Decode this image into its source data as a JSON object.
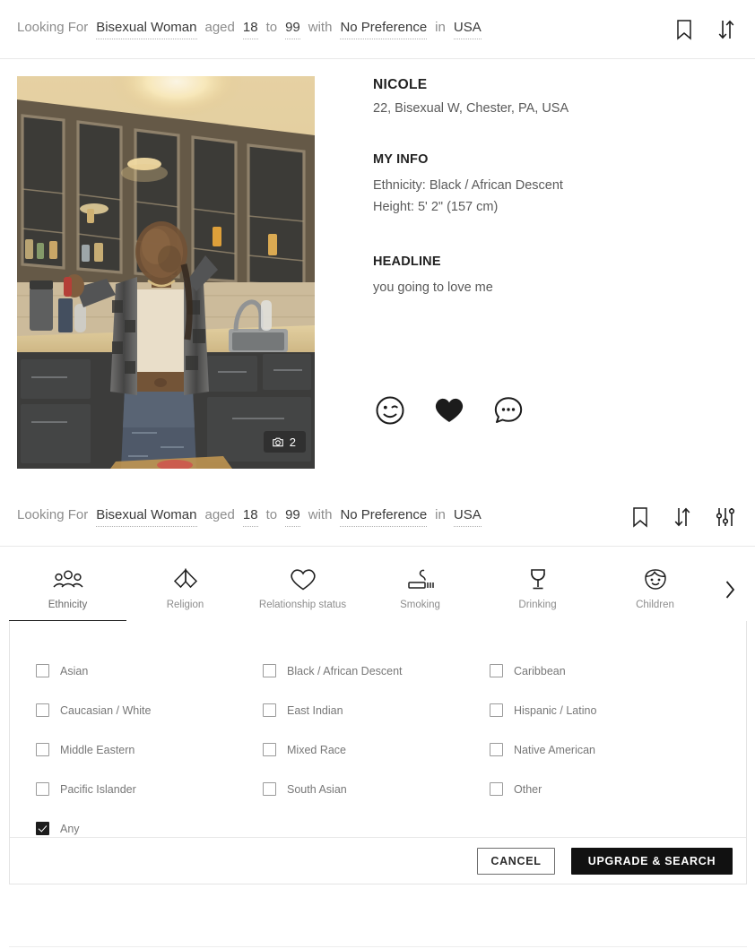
{
  "search_bar_top": {
    "segments": [
      {
        "text": "Looking For",
        "type": "word"
      },
      {
        "text": "Bisexual Woman",
        "type": "value"
      },
      {
        "text": "aged",
        "type": "word"
      },
      {
        "text": "18",
        "type": "value"
      },
      {
        "text": "to",
        "type": "word"
      },
      {
        "text": "99",
        "type": "value"
      },
      {
        "text": "with",
        "type": "word"
      },
      {
        "text": "No Preference",
        "type": "value"
      },
      {
        "text": "in",
        "type": "word"
      },
      {
        "text": "USA",
        "type": "value"
      }
    ],
    "icons": [
      "bookmark-icon",
      "sort-icon"
    ]
  },
  "search_bar_bottom": {
    "segments": [
      {
        "text": "Looking For",
        "type": "word"
      },
      {
        "text": "Bisexual Woman",
        "type": "value"
      },
      {
        "text": "aged",
        "type": "word"
      },
      {
        "text": "18",
        "type": "value"
      },
      {
        "text": "to",
        "type": "word"
      },
      {
        "text": "99",
        "type": "value"
      },
      {
        "text": "with",
        "type": "word"
      },
      {
        "text": "No Preference",
        "type": "value"
      },
      {
        "text": "in",
        "type": "word"
      },
      {
        "text": "USA",
        "type": "value"
      }
    ],
    "icons": [
      "bookmark-icon",
      "sort-icon",
      "filter-sliders-icon"
    ]
  },
  "profile": {
    "name": "NICOLE",
    "summary": "22, Bisexual W, Chester, PA, USA",
    "photo_count": "2",
    "photo_badge_icon": "camera-icon",
    "sections": [
      {
        "heading": "MY INFO",
        "lines": [
          "Ethnicity: Black / African Descent",
          "Height: 5' 2\" (157 cm)"
        ]
      },
      {
        "heading": "HEADLINE",
        "lines": [
          "you going to love me"
        ]
      }
    ],
    "actions": [
      {
        "name": "wink-icon",
        "label": "Wink"
      },
      {
        "name": "heart-icon",
        "label": "Favorite"
      },
      {
        "name": "chat-bubble-icon",
        "label": "Message"
      }
    ]
  },
  "filter_tabs": {
    "active_index": 0,
    "items": [
      {
        "label": "Ethnicity",
        "icon": "people-group-icon"
      },
      {
        "label": "Religion",
        "icon": "praying-hands-icon"
      },
      {
        "label": "Relationship status",
        "icon": "heart-outline-icon"
      },
      {
        "label": "Smoking",
        "icon": "cigarette-icon"
      },
      {
        "label": "Drinking",
        "icon": "wine-glass-icon"
      },
      {
        "label": "Children",
        "icon": "child-face-icon"
      }
    ],
    "scroll_next_icon": "chevron-right-icon"
  },
  "ethnicity_options": [
    {
      "label": "Asian",
      "checked": false
    },
    {
      "label": "Black / African Descent",
      "checked": false
    },
    {
      "label": "Caribbean",
      "checked": false
    },
    {
      "label": "Caucasian / White",
      "checked": false
    },
    {
      "label": "East Indian",
      "checked": false
    },
    {
      "label": "Hispanic / Latino",
      "checked": false
    },
    {
      "label": "Middle Eastern",
      "checked": false
    },
    {
      "label": "Mixed Race",
      "checked": false
    },
    {
      "label": "Native American",
      "checked": false
    },
    {
      "label": "Pacific Islander",
      "checked": false
    },
    {
      "label": "South Asian",
      "checked": false
    },
    {
      "label": "Other",
      "checked": false
    },
    {
      "label": "Any",
      "checked": true
    }
  ],
  "footer": {
    "cancel_label": "CANCEL",
    "primary_label": "UPGRADE & SEARCH"
  },
  "colors": {
    "accent": "#111111",
    "muted_text": "#8d8d8d",
    "value_text": "#3a3a3a",
    "border": "#e3e3e3"
  }
}
